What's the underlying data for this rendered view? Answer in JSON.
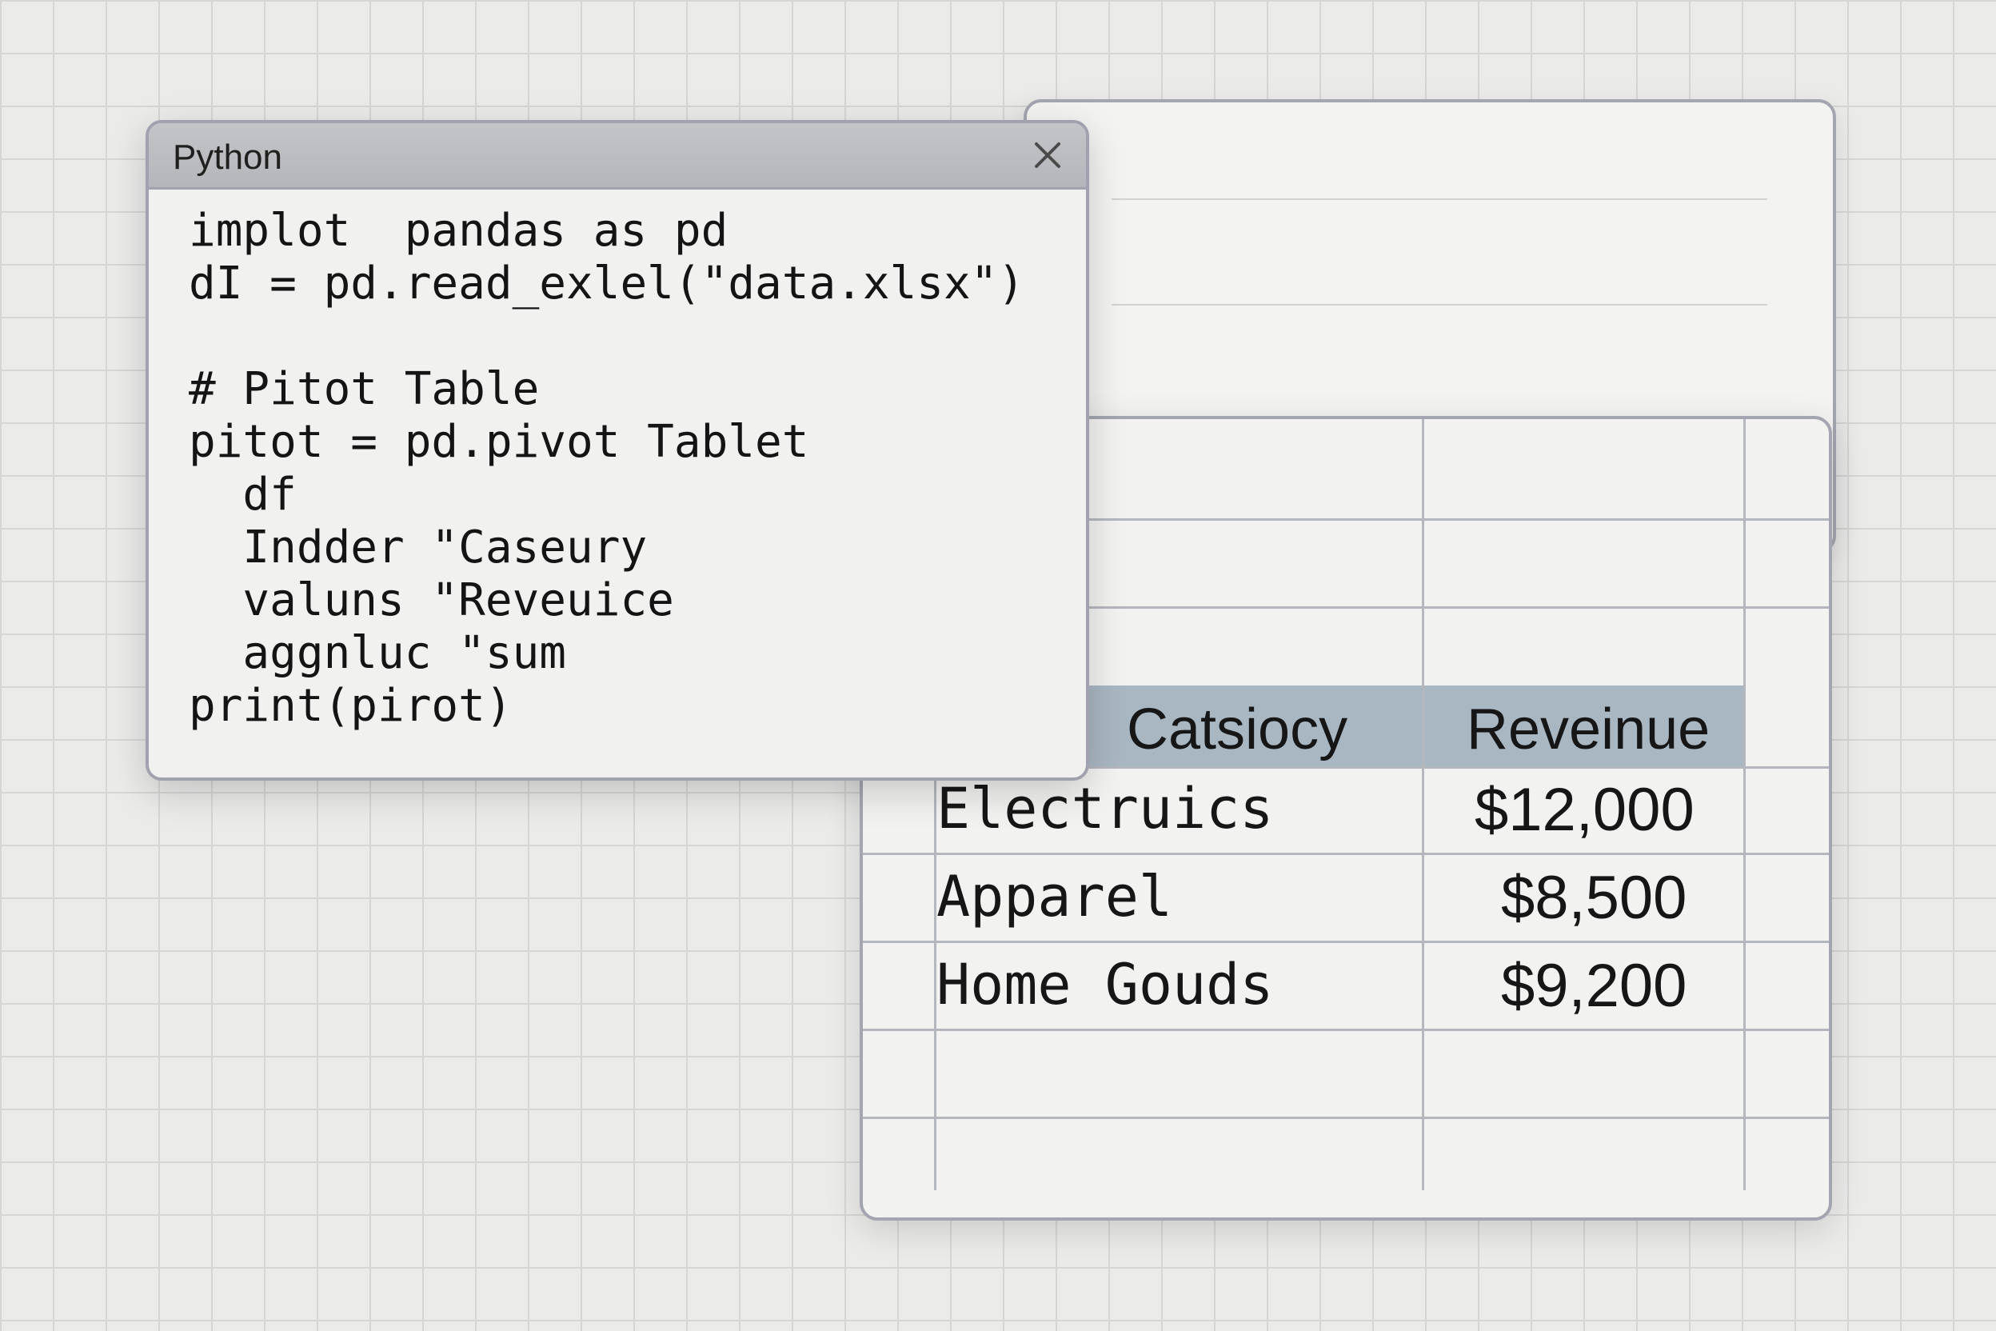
{
  "python_window": {
    "title": "Python",
    "close_icon": "close-icon",
    "code_lines": [
      "implot  pandas as pd",
      "dI = pd.read_exlel(\"data.xlsx\")",
      "",
      "# Pitot Table",
      "pitot = pd.pivot Tablet",
      "  df",
      "  Indder \"Caseury",
      "  valuns \"Reveuice",
      "  aggnluc \"sum",
      "print(pirot)"
    ]
  },
  "spreadsheet": {
    "headers": [
      "Catsiocy",
      "Reveinue"
    ],
    "rows": [
      {
        "category": "Electruics",
        "revenue": "$12,000"
      },
      {
        "category": "Apparel",
        "revenue": "$8,500"
      },
      {
        "category": "Home Gouds",
        "revenue": "$9,200"
      }
    ],
    "colors": {
      "header_fill": "#a9b7c3",
      "grid_line": "#b4b7be",
      "panel_border": "#a3a6b0"
    }
  }
}
